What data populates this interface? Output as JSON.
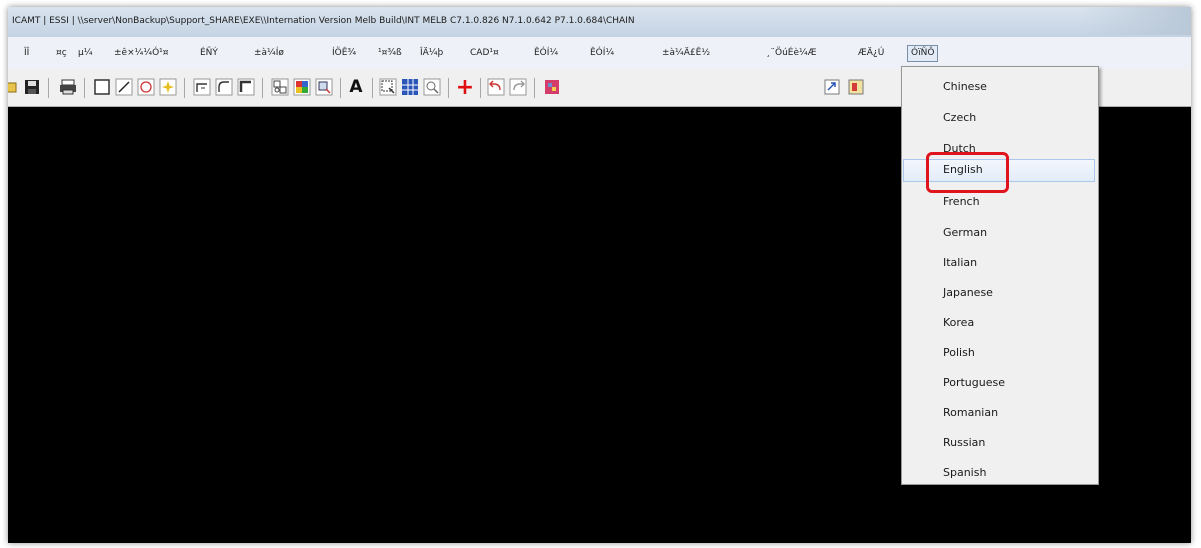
{
  "window": {
    "title": "ICAMT | ESSI | \\\\server\\NonBackup\\Support_SHARE\\EXE\\\\Internation Version Melb Build\\INT MELB C7.1.0.826 N7.1.0.642 P7.1.0.684\\CHAIN"
  },
  "menu": {
    "items": [
      "ÎÎ",
      "¤ç",
      "µ¼",
      "±ê×¼¼Ó¹¤",
      "ÉÑÝ",
      "±à¼­Íø",
      "ÍÖÊ¾",
      "¹¤¾ß",
      "ÎÄ¼þ",
      "CAD¹¤",
      "ÊÓÍ¼",
      "ÊÓÍ¼",
      "±à¼­Ä£Ê½",
      "¸¨ÖúÉè¼Æ",
      "ÆÄ¿Ú"
    ],
    "language_menu_label": "ÓïÑÔ"
  },
  "toolbar": {
    "buttons": [
      {
        "icon": "open-icon"
      },
      {
        "icon": "save-icon"
      },
      {
        "icon": "print-icon"
      },
      {
        "icon": "rectangle-icon"
      },
      {
        "icon": "line-icon"
      },
      {
        "icon": "circle-icon"
      },
      {
        "icon": "point-icon"
      },
      {
        "icon": "corner-icon"
      },
      {
        "icon": "fillet-icon"
      },
      {
        "icon": "chamfer-icon"
      },
      {
        "icon": "group-icon"
      },
      {
        "icon": "color-icon"
      },
      {
        "icon": "layer-icon"
      },
      {
        "icon": "text-icon",
        "glyph": "A"
      },
      {
        "icon": "select-icon"
      },
      {
        "icon": "grid-icon"
      },
      {
        "icon": "zoom-icon"
      },
      {
        "icon": "origin-icon",
        "glyph": "+"
      },
      {
        "icon": "undo-icon"
      },
      {
        "icon": "redo-icon"
      },
      {
        "icon": "nest-icon"
      },
      {
        "icon": "export-icon"
      },
      {
        "icon": "report-icon"
      }
    ]
  },
  "language_dropdown": {
    "options": [
      "Chinese",
      "Czech",
      "Dutch",
      "English",
      "French",
      "German",
      "Italian",
      "Japanese",
      "Korea",
      "Polish",
      "Portuguese",
      "Romanian",
      "Russian",
      "Spanish"
    ],
    "hovered": "English"
  },
  "colors": {
    "canvas": "#000000",
    "highlight": "#e0141c",
    "hover": "#e2ecf8"
  }
}
